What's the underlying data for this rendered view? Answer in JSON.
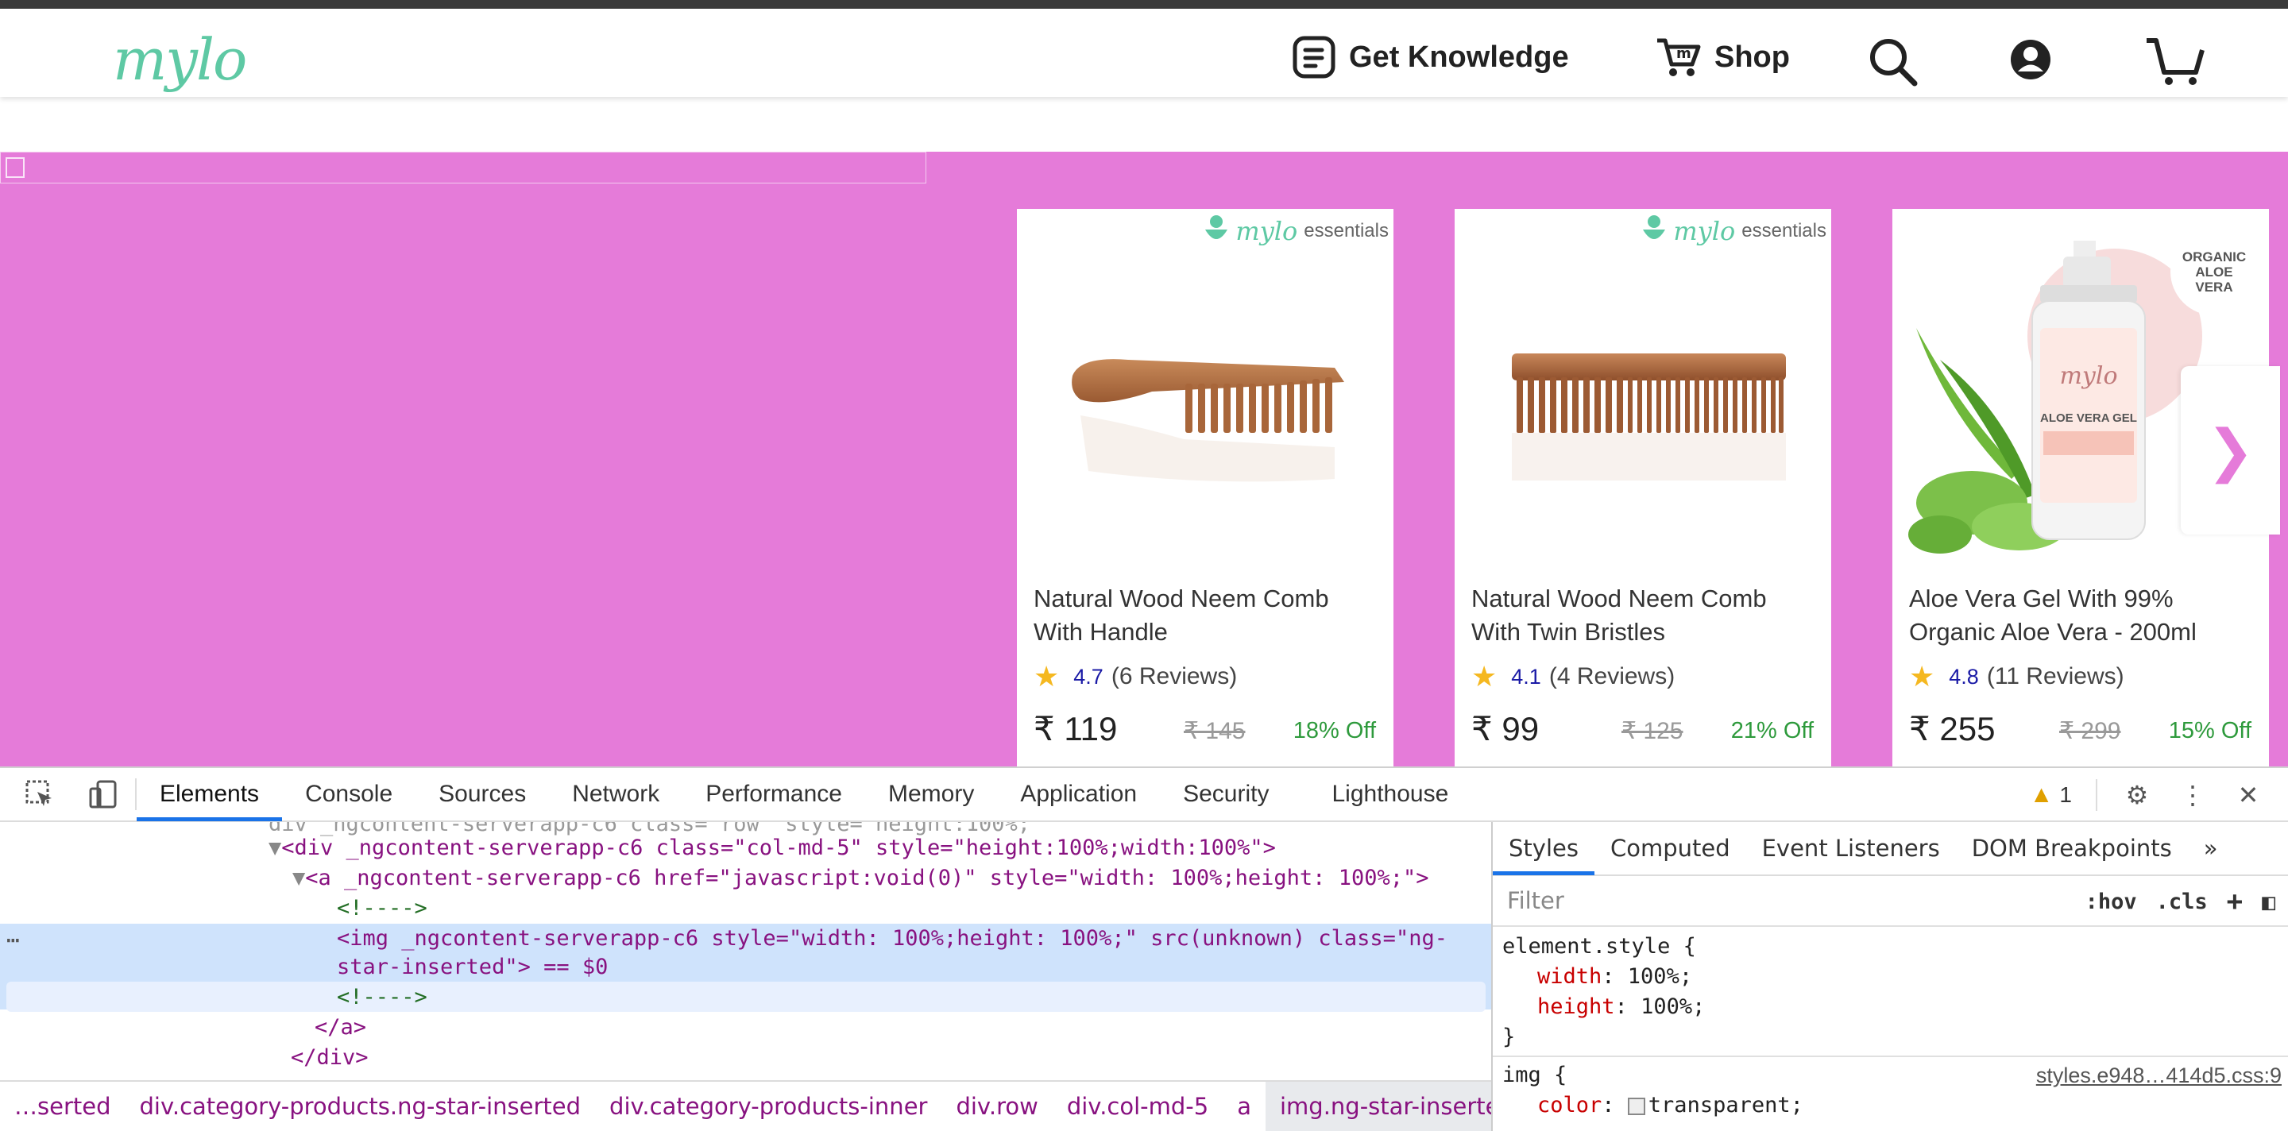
{
  "header": {
    "logo": "mylo",
    "nav": [
      {
        "label": "Get Knowledge",
        "icon": "book-icon"
      },
      {
        "label": "Shop",
        "icon": "cart-m-icon"
      }
    ],
    "icons": [
      "search-icon",
      "user-icon",
      "cart-icon"
    ]
  },
  "products": [
    {
      "name": "Natural Wood Neem Comb With Handle",
      "rating": "4.7",
      "reviews": "(6 Reviews)",
      "price": "₹ 119",
      "mrp": "₹ 145",
      "off": "18% Off",
      "badge": "essentials",
      "badge_logo": "mylo"
    },
    {
      "name": "Natural Wood Neem Comb With Twin Bristles",
      "rating": "4.1",
      "reviews": "(4 Reviews)",
      "price": "₹ 99",
      "mrp": "₹ 125",
      "off": "21% Off",
      "badge": "essentials",
      "badge_logo": "mylo"
    },
    {
      "name": "Aloe Vera Gel With 99% Organic Aloe Vera - 200ml",
      "rating": "4.8",
      "reviews": "(11 Reviews)",
      "price": "₹ 255",
      "mrp": "₹ 299",
      "off": "15% Off",
      "badge": "ORGANIC ALOE VERA",
      "bottle_label": "ALOE VERA GEL"
    }
  ],
  "carousel": {
    "next": "❯"
  },
  "devtools": {
    "tabs": [
      "Elements",
      "Console",
      "Sources",
      "Network",
      "Performance",
      "Memory",
      "Application",
      "Security",
      "Lighthouse"
    ],
    "active_tab": "Elements",
    "warnings": "1",
    "dom_lines": [
      "<div _ngcontent-serverapp-c6 class=\"col-md-5\" style=\"height:100%;width:100%\">",
      "<a _ngcontent-serverapp-c6 href=\"javascript:void(0)\" style=\"width: 100%;height: 100%;\">",
      "<!---->",
      "<img _ngcontent-serverapp-c6 style=\"width: 100%;height: 100%;\" src(unknown) class=\"ng-",
      "star-inserted\"> == $0",
      "<!---->",
      "</a>",
      "</div>"
    ],
    "breadcrumbs": [
      "…serted",
      "div.category-products.ng-star-inserted",
      "div.category-products-inner",
      "div.row",
      "div.col-md-5",
      "a",
      "img.ng-star-inserted",
      "…"
    ],
    "side_tabs": [
      "Styles",
      "Computed",
      "Event Listeners",
      "DOM Breakpoints",
      "»"
    ],
    "filter_placeholder": "Filter",
    "hov": ":hov",
    "cls": ".cls",
    "element_style": "element.style {",
    "rules": [
      {
        "prop": "width",
        "val": "100%;"
      },
      {
        "prop": "height",
        "val": "100%;"
      }
    ],
    "close_brace": "}",
    "img_rule": "img {",
    "img_source": "styles.e948…414d5.css:9",
    "img_color_prop": "color",
    "img_color_val": "transparent;"
  }
}
